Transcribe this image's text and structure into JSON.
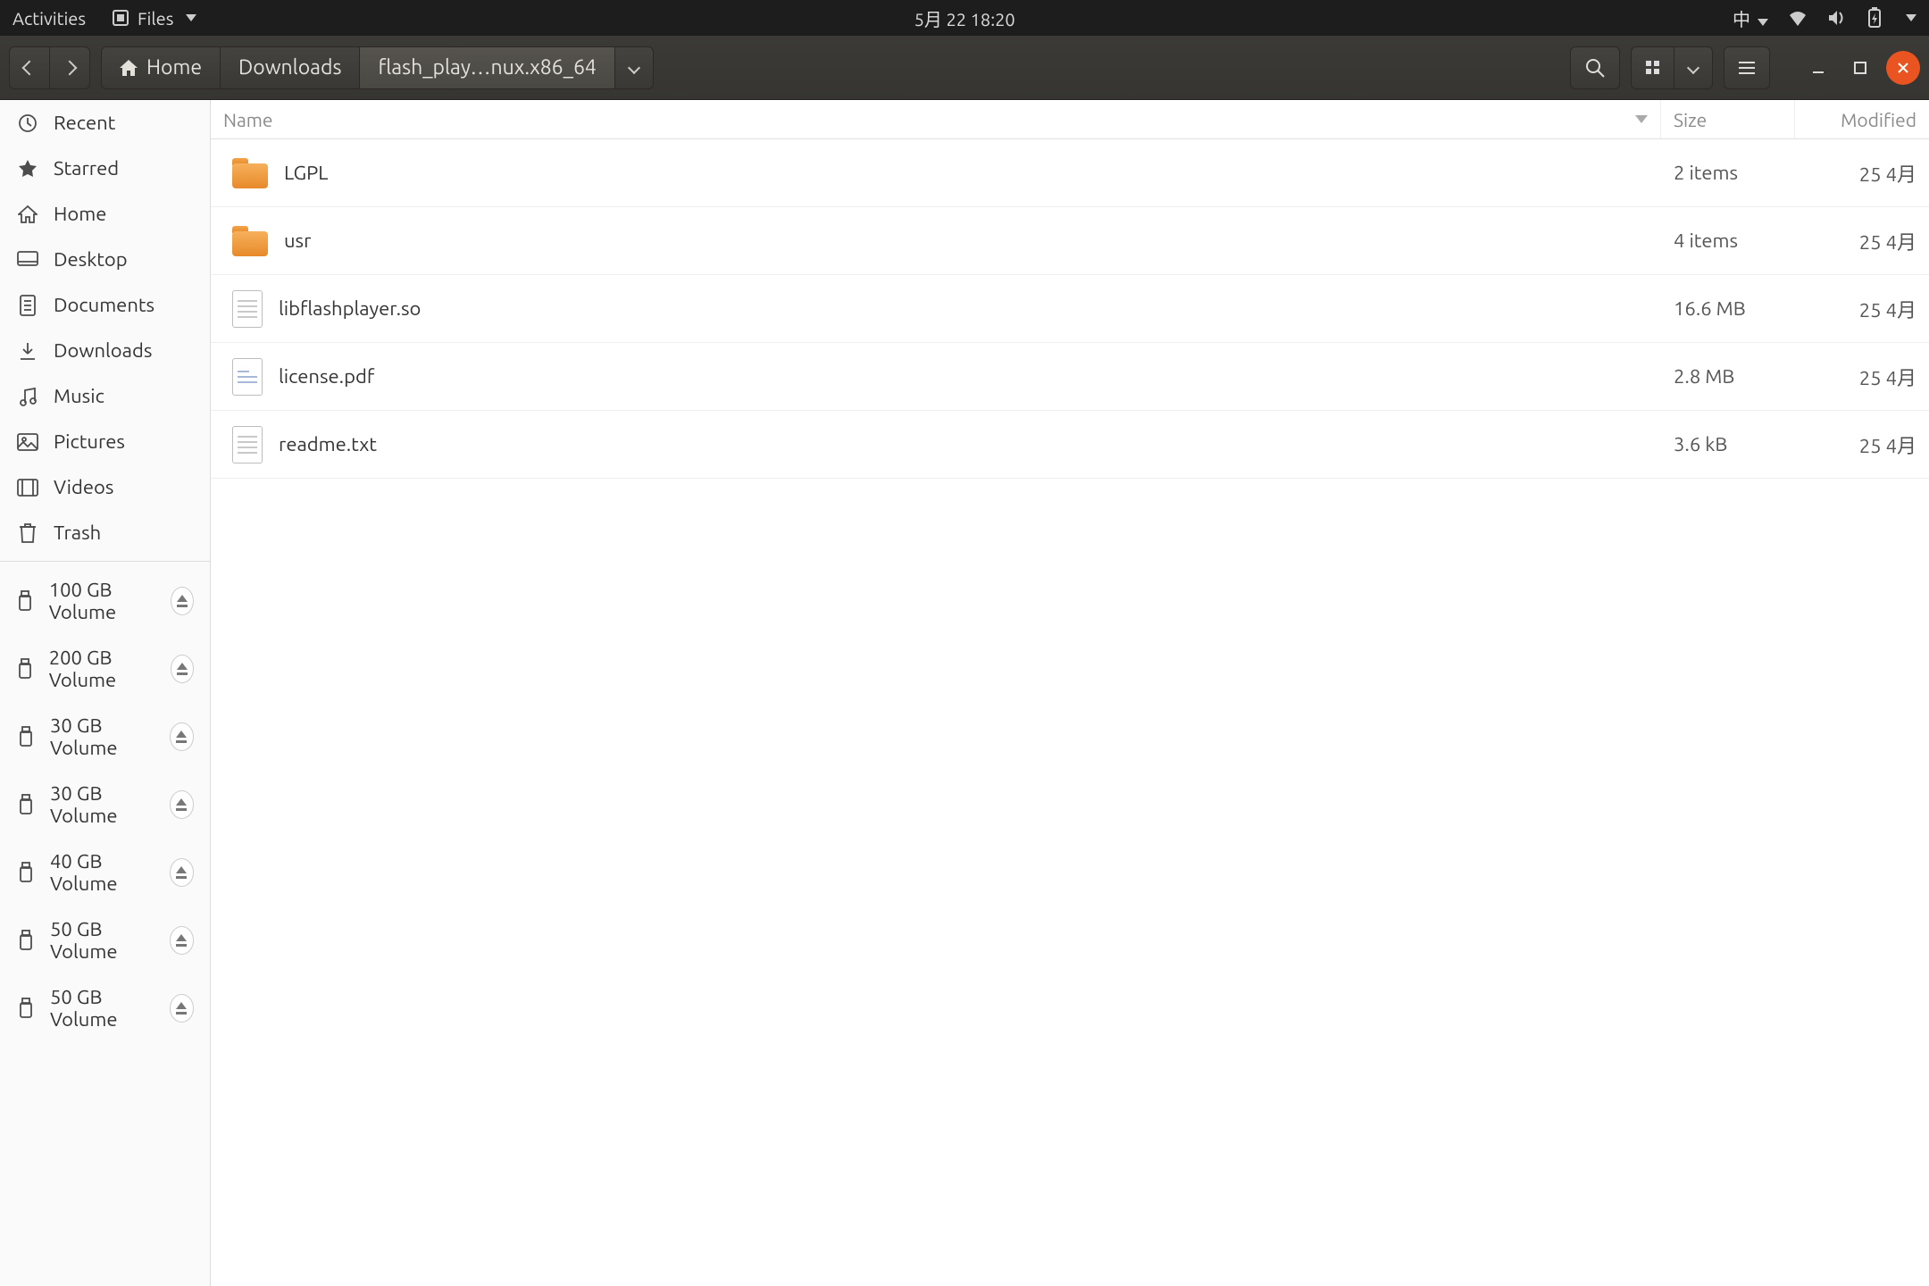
{
  "topbar": {
    "activities": "Activities",
    "app_name": "Files",
    "datetime": "5月 22  18:20",
    "input_method": "中"
  },
  "header": {
    "crumbs": [
      "Home",
      "Downloads",
      "flash_play…nux.x86_64"
    ]
  },
  "sidebar": {
    "places": [
      {
        "label": "Recent",
        "icon": "clock"
      },
      {
        "label": "Starred",
        "icon": "star"
      },
      {
        "label": "Home",
        "icon": "home"
      },
      {
        "label": "Desktop",
        "icon": "desktop"
      },
      {
        "label": "Documents",
        "icon": "document"
      },
      {
        "label": "Downloads",
        "icon": "download"
      },
      {
        "label": "Music",
        "icon": "music"
      },
      {
        "label": "Pictures",
        "icon": "picture"
      },
      {
        "label": "Videos",
        "icon": "video"
      },
      {
        "label": "Trash",
        "icon": "trash"
      }
    ],
    "volumes": [
      {
        "label": "100 GB Volume"
      },
      {
        "label": "200 GB Volume"
      },
      {
        "label": "30 GB Volume"
      },
      {
        "label": "30 GB Volume"
      },
      {
        "label": "40 GB Volume"
      },
      {
        "label": "50 GB Volume"
      },
      {
        "label": "50 GB Volume"
      }
    ]
  },
  "columns": {
    "name": "Name",
    "size": "Size",
    "modified": "Modified"
  },
  "files": [
    {
      "name": "LGPL",
      "type": "folder",
      "size": "2 items",
      "modified": "25 4月"
    },
    {
      "name": "usr",
      "type": "folder",
      "size": "4 items",
      "modified": "25 4月"
    },
    {
      "name": "libflashplayer.so",
      "type": "file",
      "size": "16.6 MB",
      "modified": "25 4月"
    },
    {
      "name": "license.pdf",
      "type": "pdf",
      "size": "2.8 MB",
      "modified": "25 4月"
    },
    {
      "name": "readme.txt",
      "type": "file",
      "size": "3.6 kB",
      "modified": "25 4月"
    }
  ]
}
